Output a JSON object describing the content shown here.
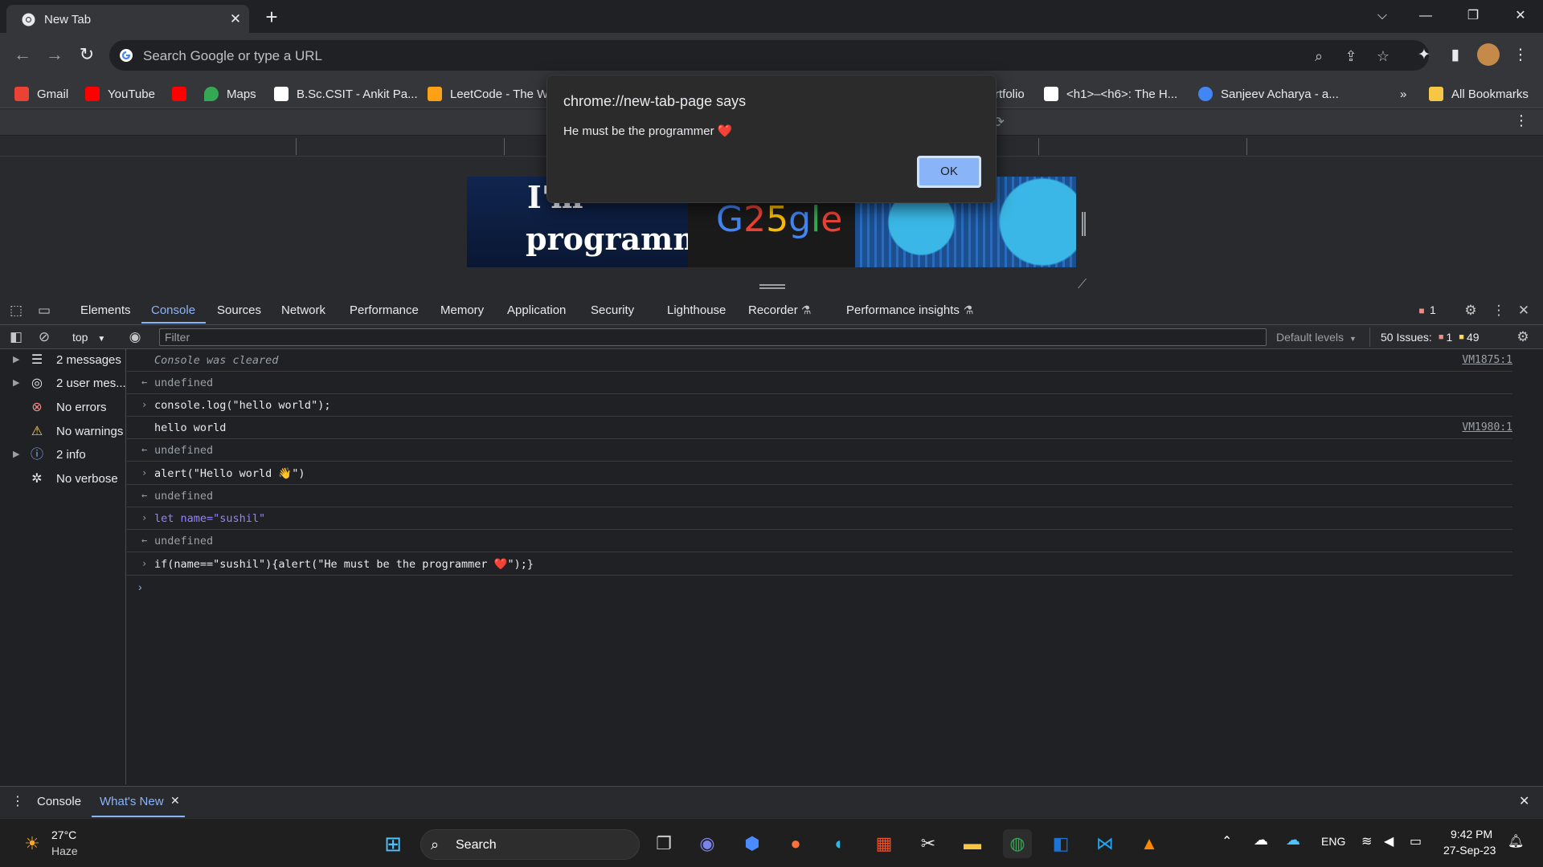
{
  "browser": {
    "tab_title": "New Tab",
    "omnibox_placeholder": "Search Google or type a URL",
    "bookmarks": [
      {
        "label": "Gmail",
        "color": "#ea4335"
      },
      {
        "label": "YouTube",
        "color": "#ff0000"
      },
      {
        "label": "",
        "color": "#ff0000"
      },
      {
        "label": "Maps",
        "color": "#34a853"
      },
      {
        "label": "B.Sc.CSIT - Ankit Pa...",
        "color": "#ffffff"
      },
      {
        "label": "LeetCode - The W",
        "color": "#ffa116"
      },
      {
        "label": "rtfolio",
        "color": ""
      },
      {
        "label": "<h1>–<h6>: The H...",
        "color": "#ffffff"
      },
      {
        "label": "Sanjeev Acharya - a...",
        "color": "#4285f4"
      }
    ],
    "more_bookmarks": "»",
    "all_bookmarks": "All Bookmarks"
  },
  "doodle": {
    "text_line1": "I'm",
    "text_line2": "programm",
    "logo": "G25gle"
  },
  "alert": {
    "title": "chrome://new-tab-page says",
    "message": "He must be the programmer ❤️",
    "ok_label": "OK"
  },
  "devtools": {
    "tabs": [
      "Elements",
      "Console",
      "Sources",
      "Network",
      "Performance",
      "Memory",
      "Application",
      "Security",
      "Lighthouse",
      "Recorder",
      "Performance insights"
    ],
    "active_tab": "Console",
    "error_badge": "1",
    "context": "top",
    "filter_placeholder": "Filter",
    "default_levels": "Default levels",
    "issues_label": "50 Issues:",
    "issues_errors": "1",
    "issues_warnings": "49",
    "sidebar": [
      {
        "label": "2 messages",
        "icon": "list-icon",
        "expandable": true
      },
      {
        "label": "2 user mes...",
        "icon": "user-icon",
        "expandable": true
      },
      {
        "label": "No errors",
        "icon": "error-icon",
        "expandable": false
      },
      {
        "label": "No warnings",
        "icon": "warning-icon",
        "expandable": false
      },
      {
        "label": "2 info",
        "icon": "info-icon",
        "expandable": true
      },
      {
        "label": "No verbose",
        "icon": "bug-icon",
        "expandable": false
      }
    ],
    "console": {
      "cleared": "Console was cleared",
      "cleared_src": "VM1875:1",
      "undefined": "undefined",
      "cmd1": "console.log(\"hello world\");",
      "out1": "hello world",
      "out1_src": "VM1980:1",
      "cmd2": "alert(\"Hello world 👋\")",
      "cmd3": "let name=\"sushil\"",
      "cmd4": "if(name==\"sushil\"){alert(\"He must be the programmer ❤️\");}"
    },
    "drawer_tabs": [
      "Console",
      "What's New"
    ],
    "drawer_active": "What's New"
  },
  "taskbar": {
    "weather_temp": "27°C",
    "weather_desc": "Haze",
    "search_label": "Search",
    "lang": "ENG",
    "time": "9:42 PM",
    "date": "27-Sep-23"
  }
}
